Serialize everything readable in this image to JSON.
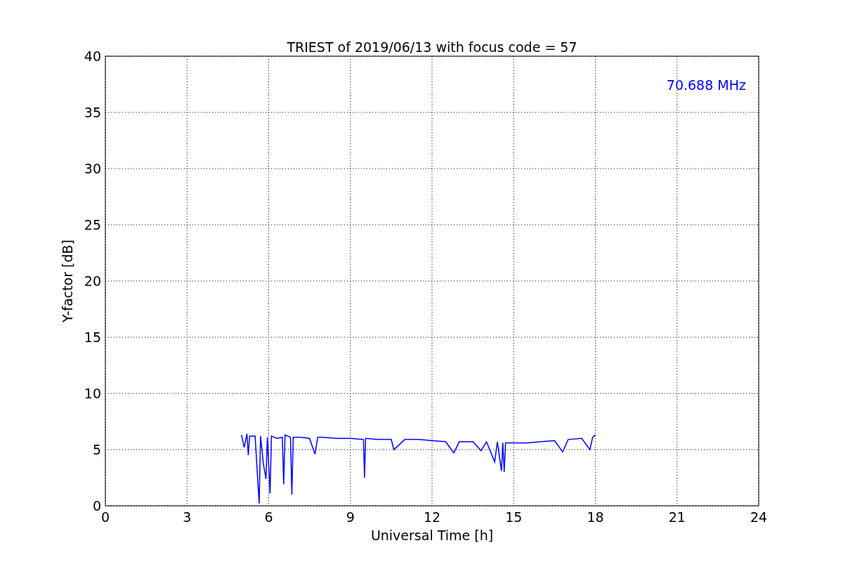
{
  "chart_data": {
    "type": "line",
    "title": "TRIEST of 2019/06/13 with focus code = 57",
    "xlabel": "Universal Time [h]",
    "ylabel": "Y-factor [dB]",
    "x": [
      5.0,
      5.1,
      5.2,
      5.25,
      5.3,
      5.5,
      5.65,
      5.7,
      5.8,
      5.9,
      5.95,
      6.05,
      6.1,
      6.3,
      6.5,
      6.55,
      6.6,
      6.8,
      6.85,
      6.9,
      7.2,
      7.5,
      7.7,
      7.8,
      8.0,
      8.5,
      9.0,
      9.48,
      9.52,
      9.56,
      10.0,
      10.5,
      10.6,
      11.0,
      11.5,
      12.0,
      12.5,
      12.8,
      13.0,
      13.5,
      13.8,
      14.0,
      14.3,
      14.4,
      14.55,
      14.6,
      14.65,
      14.7,
      15.0,
      15.5,
      16.0,
      16.5,
      16.8,
      17.0,
      17.5,
      17.8,
      17.9,
      18.0
    ],
    "series": [
      {
        "name": "70.688 MHz",
        "color": "#0000ff",
        "values": [
          6.3,
          5.2,
          6.4,
          4.5,
          6.2,
          6.2,
          0.2,
          6.2,
          3.8,
          2.4,
          6.1,
          1.1,
          6.2,
          6.0,
          6.1,
          1.9,
          6.3,
          6.1,
          1.0,
          6.1,
          6.1,
          6.0,
          4.6,
          6.1,
          6.1,
          6.0,
          6.0,
          5.9,
          2.5,
          6.0,
          5.9,
          5.9,
          5.0,
          5.9,
          5.9,
          5.8,
          5.7,
          4.7,
          5.7,
          5.7,
          4.9,
          5.7,
          3.9,
          5.7,
          3.1,
          5.6,
          3.0,
          5.6,
          5.6,
          5.6,
          5.7,
          5.8,
          4.8,
          5.9,
          6.0,
          5.0,
          6.1,
          6.3
        ]
      }
    ],
    "xlim": [
      0,
      24
    ],
    "ylim": [
      0,
      40
    ],
    "xticks": [
      0,
      3,
      6,
      9,
      12,
      15,
      18,
      21,
      24
    ],
    "yticks": [
      0,
      5,
      10,
      15,
      20,
      25,
      30,
      35,
      40
    ],
    "grid": true
  }
}
